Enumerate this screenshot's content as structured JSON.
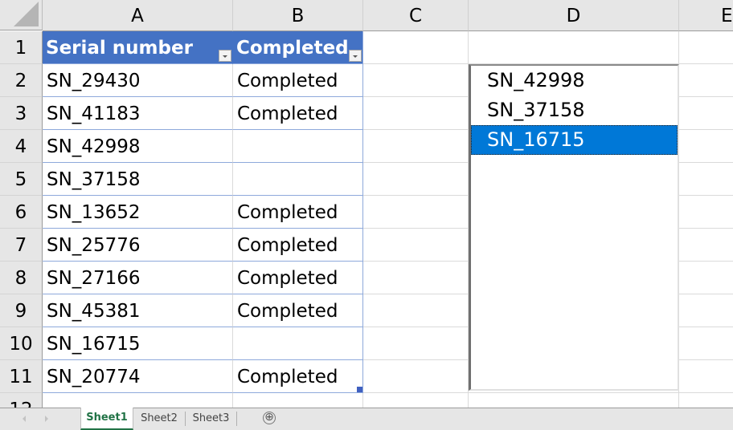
{
  "spreadsheet": {
    "column_headers": [
      "A",
      "B",
      "C",
      "D",
      "E"
    ],
    "row_headers": [
      "1",
      "2",
      "3",
      "4",
      "5",
      "6",
      "7",
      "8",
      "9",
      "10",
      "11",
      "12"
    ],
    "table": {
      "headers": [
        "Serial number",
        "Completed"
      ],
      "rows": [
        [
          "SN_29430",
          "Completed"
        ],
        [
          "SN_41183",
          "Completed"
        ],
        [
          "SN_42998",
          ""
        ],
        [
          "SN_37158",
          ""
        ],
        [
          "SN_13652",
          "Completed"
        ],
        [
          "SN_25776",
          "Completed"
        ],
        [
          "SN_27166",
          "Completed"
        ],
        [
          "SN_45381",
          "Completed"
        ],
        [
          "SN_16715",
          ""
        ],
        [
          "SN_20774",
          "Completed"
        ]
      ],
      "header_color": "#4472c4"
    }
  },
  "listbox": {
    "items": [
      "SN_42998",
      "SN_37158",
      "SN_16715"
    ],
    "selected_index": 2,
    "selected_color": "#0078d7"
  },
  "sheet_tabs": {
    "tabs": [
      "Sheet1",
      "Sheet2",
      "Sheet3"
    ],
    "active": "Sheet1",
    "add_icon": "⊕",
    "active_color": "#217346"
  }
}
